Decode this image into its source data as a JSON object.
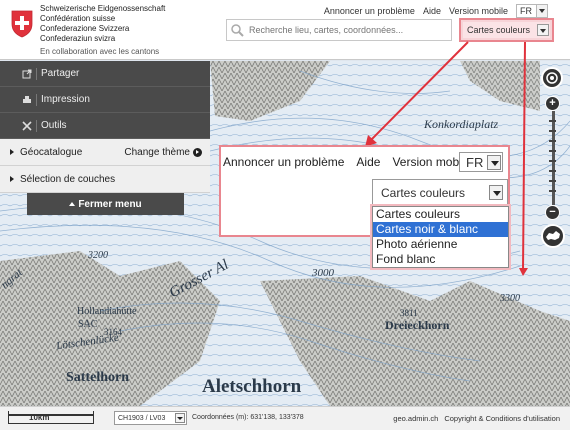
{
  "header": {
    "confederation_lines": [
      "Schweizerische Eidgenossenschaft",
      "Confédération suisse",
      "Confederazione Svizzera",
      "Confederaziun svizra"
    ],
    "collaboration": "En collaboration avec les cantons",
    "search_placeholder": "Recherche lieu, cartes, coordonnées...",
    "links": {
      "report": "Annoncer un problème",
      "help": "Aide",
      "mobile": "Version mobile"
    },
    "language": "FR",
    "background_selected": "Cartes couleurs"
  },
  "menu": {
    "items": [
      "Partager",
      "Impression",
      "Outils"
    ],
    "panels": {
      "catalog": "Géocatalogue",
      "change_theme": "Change thème",
      "layers": "Sélection de couches"
    },
    "close_label": "Fermer menu"
  },
  "map": {
    "labels": {
      "konkordia": "Konkordiaplatz",
      "grosser": "Grosser Al",
      "hollandia": "Hollandiahütte",
      "sac": "SAC",
      "lotschen": "Lötschenlücke",
      "h3164": "3164",
      "sattelhorn": "Sattelhorn",
      "aletsch": "Aletschhorn",
      "dreieck": "Dreieckhorn",
      "h3200": "3200",
      "h3000": "3000",
      "h3811": "3811",
      "h3300": "3300",
      "ngrat": "ngrat"
    }
  },
  "callout": {
    "report": "Annoncer un problème",
    "help": "Aide",
    "mobile": "Version mobile",
    "language": "FR",
    "background_selected": "Cartes couleurs",
    "options": [
      "Cartes couleurs",
      "Cartes noir & blanc",
      "Photo aérienne",
      "Fond blanc"
    ],
    "highlighted_option": "Cartes noir & blanc"
  },
  "footer": {
    "scale": "10km",
    "projection": "CH1903 / LV03",
    "coordinates": "Coordonnées (m): 631'138, 133'378",
    "site": "geo.admin.ch",
    "copyright": "Copyright & Conditions d'utilisation"
  },
  "colors": {
    "accent_red": "#e0323c",
    "highlight_border": "#e9868f",
    "selected_option": "#2f71d4",
    "menu_dark": "#4a4a4a"
  }
}
